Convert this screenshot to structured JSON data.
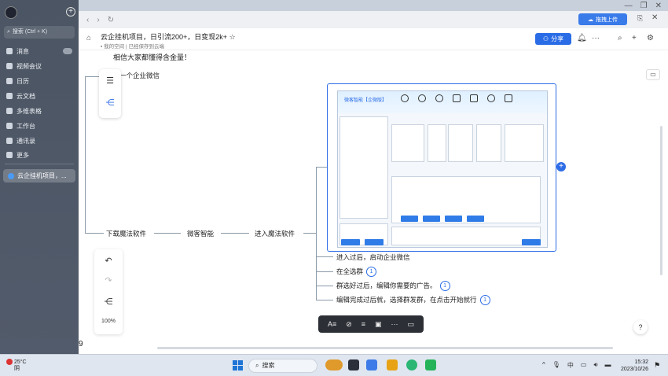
{
  "sidebar": {
    "search_label": "搜索 (Ctrl + K)",
    "items": [
      {
        "label": "消息",
        "icon": "message-icon"
      },
      {
        "label": "视频会议",
        "icon": "video-icon"
      },
      {
        "label": "日历",
        "icon": "calendar-icon"
      },
      {
        "label": "云文档",
        "icon": "doc-icon"
      },
      {
        "label": "多维表格",
        "icon": "table-icon"
      },
      {
        "label": "工作台",
        "icon": "grid-icon"
      },
      {
        "label": "通讯录",
        "icon": "contacts-icon"
      },
      {
        "label": "更多",
        "icon": "more-icon"
      }
    ],
    "open_doc": "云企挂机项目，..."
  },
  "toolbar": {
    "upload_label": "拖拽上传"
  },
  "doc": {
    "title": "云企挂机项目，日引流200+，日变现2k+",
    "breadcrumb": "我的空间",
    "save_status": "已经保存到云端",
    "share_label": "分享"
  },
  "mindmap": {
    "top_partial": "相信大家都懂得含金量！",
    "node_wechat": "一个企业微信",
    "download": "下载魔法软件",
    "weizhi": "微客智能",
    "enter": "进入魔法软件",
    "steps": [
      {
        "text": "进入过后，启动企业微信",
        "badge": ""
      },
      {
        "text": "在全选群",
        "badge": "1"
      },
      {
        "text": "群选好过后，编辑你需要的广告。",
        "badge": "1"
      },
      {
        "text": "编辑完成过后就，选择群发群，在点击开始就行",
        "badge": "1"
      }
    ]
  },
  "screenshot_inner": {
    "title": "微客智能【企微版】"
  },
  "zoom": "100%",
  "page_index": "9",
  "taskbar": {
    "temperature": "25°C",
    "weather": "阴",
    "search_label": "搜索",
    "ime": "中",
    "time": "15:32",
    "date": "2023/10/26"
  },
  "colors": {
    "accent": "#2f6de6",
    "sidebar_bg": "#4b5563"
  }
}
